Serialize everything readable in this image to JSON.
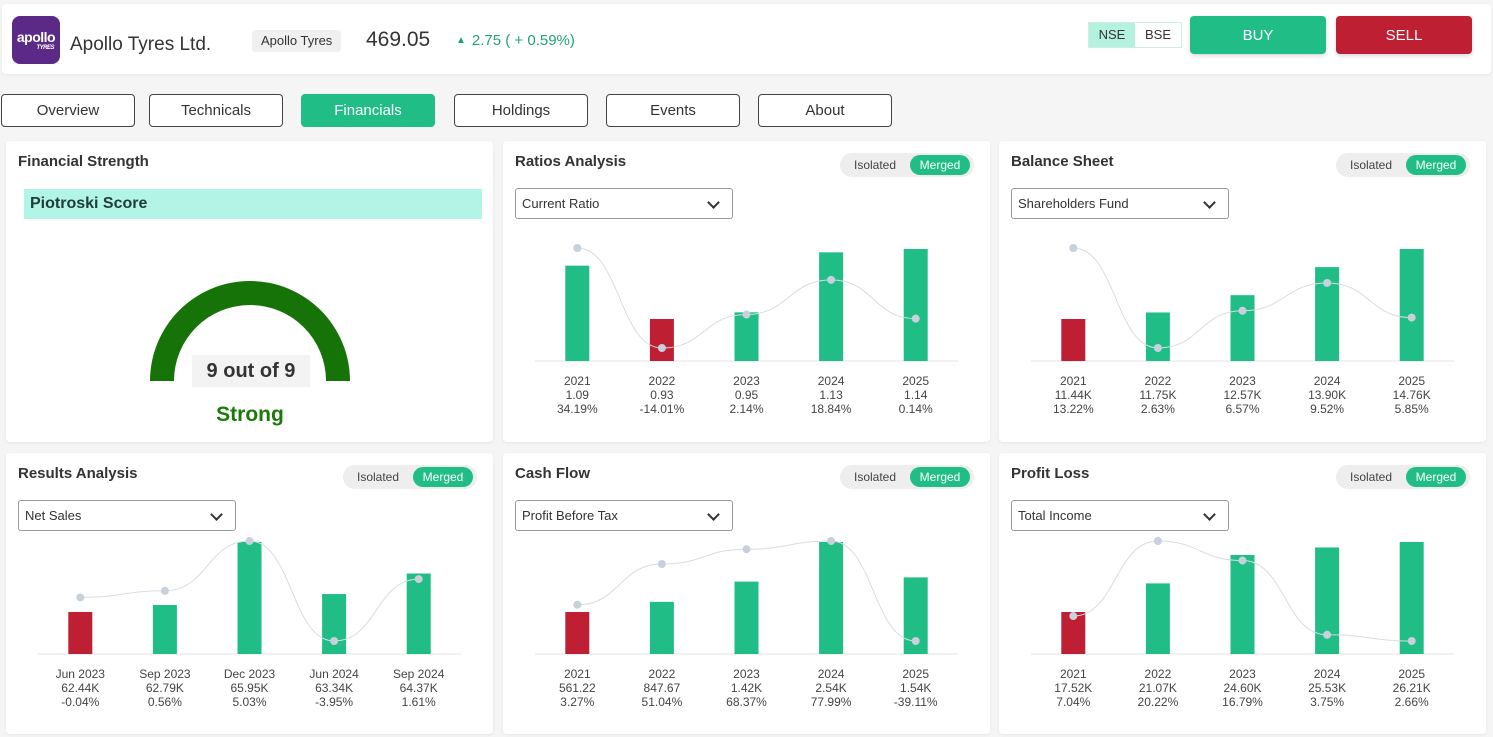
{
  "header": {
    "logo_text": "apollo",
    "logo_sub": "TYRES",
    "company_name": "Apollo Tyres Ltd.",
    "ticker": "Apollo Tyres",
    "price": "469.05",
    "change_icon": "triangle-up-icon",
    "change": "2.75 (  +  0.59%)",
    "exchanges": [
      "NSE",
      "BSE"
    ],
    "selected_exchange": "NSE",
    "buy_label": "BUY",
    "sell_label": "SELL"
  },
  "tabs": [
    "Overview",
    "Technicals",
    "Financials",
    "Holdings",
    "Events",
    "About"
  ],
  "active_tab": "Financials",
  "toggle": {
    "isolated": "Isolated",
    "merged": "Merged",
    "selected": "Merged"
  },
  "financial_strength": {
    "title": "Financial Strength",
    "label": "Piotroski Score",
    "score_text": "9 out of 9",
    "score": 9,
    "max": 9,
    "rating": "Strong"
  },
  "colors": {
    "positive": "#20be86",
    "negative": "#be1f32",
    "gauge": "#157307",
    "line": "#c8d0dc"
  },
  "chart_data": [
    {
      "panel": "ratios",
      "title": "Ratios Analysis",
      "selector": "Current Ratio",
      "type": "bar",
      "categories": [
        "2021",
        "2022",
        "2023",
        "2024",
        "2025"
      ],
      "values": [
        1.09,
        0.93,
        0.95,
        1.13,
        1.14
      ],
      "value_labels": [
        "1.09",
        "0.93",
        "0.95",
        "1.13",
        "1.14"
      ],
      "changes": [
        34.19,
        -14.01,
        2.14,
        18.84,
        0.14
      ],
      "change_labels": [
        "34.19%",
        "-14.01%",
        "2.14%",
        "18.84%",
        "0.14%"
      ]
    },
    {
      "panel": "balance",
      "title": "Balance Sheet",
      "selector": "Shareholders Fund",
      "type": "bar",
      "categories": [
        "2021",
        "2022",
        "2023",
        "2024",
        "2025"
      ],
      "values": [
        11440,
        11750,
        12570,
        13900,
        14760
      ],
      "value_labels": [
        "11.44K",
        "11.75K",
        "12.57K",
        "13.90K",
        "14.76K"
      ],
      "changes": [
        13.22,
        2.63,
        6.57,
        9.52,
        5.85
      ],
      "change_labels": [
        "13.22%",
        "2.63%",
        "6.57%",
        "9.52%",
        "5.85%"
      ]
    },
    {
      "panel": "results",
      "title": "Results Analysis",
      "selector": "Net Sales",
      "type": "bar",
      "categories": [
        "Jun 2023",
        "Sep 2023",
        "Dec 2023",
        "Jun 2024",
        "Sep 2024"
      ],
      "values": [
        62440,
        62790,
        65950,
        63340,
        64370
      ],
      "value_labels": [
        "62.44K",
        "62.79K",
        "65.95K",
        "63.34K",
        "64.37K"
      ],
      "changes": [
        -0.04,
        0.56,
        5.03,
        -3.95,
        1.61
      ],
      "change_labels": [
        "-0.04%",
        "0.56%",
        "5.03%",
        "-3.95%",
        "1.61%"
      ]
    },
    {
      "panel": "cashflow",
      "title": "Cash Flow",
      "selector": "Profit Before Tax",
      "type": "bar",
      "categories": [
        "2021",
        "2022",
        "2023",
        "2024",
        "2025"
      ],
      "values": [
        561.22,
        847.67,
        1420,
        2540,
        1540
      ],
      "value_labels": [
        "561.22",
        "847.67",
        "1.42K",
        "2.54K",
        "1.54K"
      ],
      "changes": [
        3.27,
        51.04,
        68.37,
        77.99,
        -39.11
      ],
      "change_labels": [
        "3.27%",
        "51.04%",
        "68.37%",
        "77.99%",
        "-39.11%"
      ]
    },
    {
      "panel": "profitloss",
      "title": "Profit Loss",
      "selector": "Total Income",
      "type": "bar",
      "categories": [
        "2021",
        "2022",
        "2023",
        "2024",
        "2025"
      ],
      "values": [
        17520,
        21070,
        24600,
        25530,
        26210
      ],
      "value_labels": [
        "17.52K",
        "21.07K",
        "24.60K",
        "25.53K",
        "26.21K"
      ],
      "changes": [
        7.04,
        20.22,
        16.79,
        3.75,
        2.66
      ],
      "change_labels": [
        "7.04%",
        "20.22%",
        "16.79%",
        "3.75%",
        "2.66%"
      ]
    }
  ]
}
